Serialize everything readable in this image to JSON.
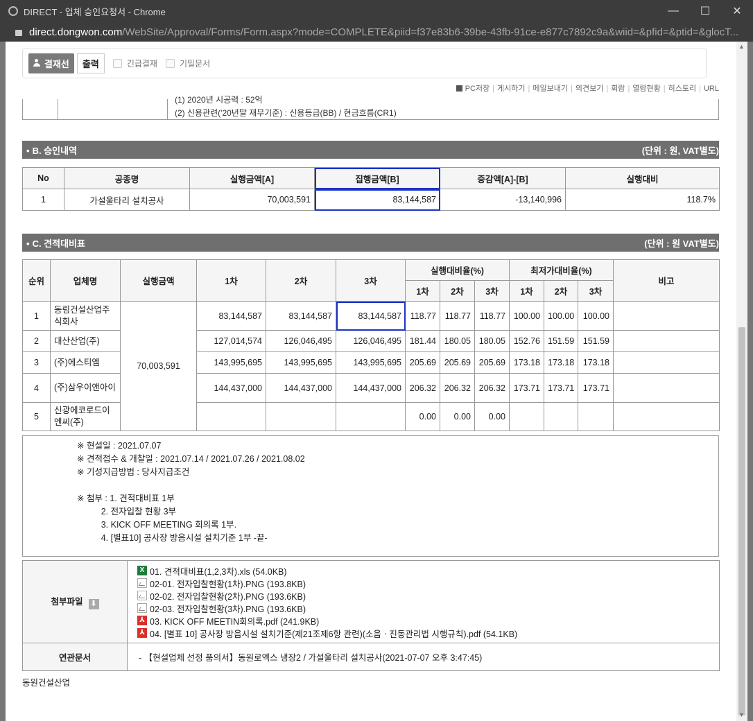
{
  "window": {
    "title": "DIRECT - 업체 승인요청서 - Chrome",
    "minimize": "—",
    "maximize": "☐",
    "close": "✕"
  },
  "address": {
    "host": "direct.dongwon.com",
    "path": "/WebSite/Approval/Forms/Form.aspx?mode=COMPLETE&piid=f37e83b6-39be-43fb-91ce-e877c7892c9a&wiid=&pfid=&ptid=&glocT..."
  },
  "toolbar": {
    "approve_label": "결재선",
    "print_label": "출력",
    "urgent_label": "긴급결재",
    "secret_label": "기밀문서"
  },
  "links": [
    "PC저장",
    "게시하기",
    "메일보내기",
    "의견보기",
    "회람",
    "열람현황",
    "히스토리",
    "URL"
  ],
  "prev_section": {
    "line1": "(1) 2020년 시공력 : 52억",
    "line2": "(2) 신용관련('20년말 재무기준) : 신용등급(BB) / 현금흐름(CR1)"
  },
  "section_b": {
    "title": "B. 승인내역",
    "unit": "(단위 : 원, VAT별도)",
    "headers": [
      "No",
      "공종명",
      "실행금액[A]",
      "집행금액[B]",
      "증감액[A]-[B]",
      "실행대비"
    ],
    "row": [
      "1",
      "가설울타리 설치공사",
      "70,003,591",
      "83,144,587",
      "-13,140,996",
      "118.7%"
    ]
  },
  "section_c": {
    "title": "C. 견적대비표",
    "unit": "(단위 : 원 VAT별도)",
    "headers": {
      "rank": "순위",
      "vendor": "업체명",
      "exec_amount": "실행금액",
      "r1": "1차",
      "r2": "2차",
      "r3": "3차",
      "exec_ratio": "실행대비율(%)",
      "min_ratio": "최저가대비율(%)",
      "sub1": "1차",
      "sub2": "2차",
      "sub3": "3차",
      "sub4": "1차",
      "sub5": "2차",
      "sub6": "3차",
      "note": "비고"
    },
    "exec_amount": "70,003,591",
    "rows": [
      {
        "rank": "1",
        "vendor": "동림건설산업주식회사",
        "r1": "83,144,587",
        "r2": "83,144,587",
        "r3": "83,144,587",
        "e1": "118.77",
        "e2": "118.77",
        "e3": "118.77",
        "m1": "100.00",
        "m2": "100.00",
        "m3": "100.00"
      },
      {
        "rank": "2",
        "vendor": "대산산업(주)",
        "r1": "127,014,574",
        "r2": "126,046,495",
        "r3": "126,046,495",
        "e1": "181.44",
        "e2": "180.05",
        "e3": "180.05",
        "m1": "152.76",
        "m2": "151.59",
        "m3": "151.59"
      },
      {
        "rank": "3",
        "vendor": "(주)에스티엠",
        "r1": "143,995,695",
        "r2": "143,995,695",
        "r3": "143,995,695",
        "e1": "205.69",
        "e2": "205.69",
        "e3": "205.69",
        "m1": "173.18",
        "m2": "173.18",
        "m3": "173.18"
      },
      {
        "rank": "4",
        "vendor": "(주)삼우이앤아이",
        "r1": "144,437,000",
        "r2": "144,437,000",
        "r3": "144,437,000",
        "e1": "206.32",
        "e2": "206.32",
        "e3": "206.32",
        "m1": "173.71",
        "m2": "173.71",
        "m3": "173.71"
      },
      {
        "rank": "5",
        "vendor": "신광에코로드이엔씨(주)",
        "r1": "",
        "r2": "",
        "r3": "",
        "e1": "0.00",
        "e2": "0.00",
        "e3": "0.00",
        "m1": "",
        "m2": "",
        "m3": ""
      }
    ]
  },
  "notes": [
    "※ 현설일 : 2021.07.07",
    "※ 견적접수 & 개찰일 : 2021.07.14 / 2021.07.26 / 2021.08.02",
    "※ 기성지급방법 : 당사지급조건",
    "",
    "※ 첨부 : 1. 견적대비표 1부",
    "          2. 전자입찰 현황 3부",
    "          3. KICK OFF MEETING 회의록 1부.",
    "          4. [별표10] 공사장 방음시설 설치기준 1부 -끝-"
  ],
  "attachments": {
    "label": "첨부파일",
    "files": [
      {
        "icon": "xls",
        "name": "01. 견적대비표(1,2,3차).xls (54.0KB)"
      },
      {
        "icon": "img",
        "name": "02-01. 전자입찰현황(1차).PNG (193.8KB)"
      },
      {
        "icon": "img",
        "name": "02-02. 전자입찰현황(2차).PNG (193.6KB)"
      },
      {
        "icon": "img",
        "name": "02-03. 전자입찰현황(3차).PNG (193.6KB)"
      },
      {
        "icon": "pdf",
        "name": "03. KICK OFF MEETIN회의록.pdf (241.9KB)"
      },
      {
        "icon": "pdf",
        "name": "04. [별표 10] 공사장 방음시설 설치기준(제21조제6항 관련)(소음ㆍ진동관리법 시행규칙).pdf (54.1KB)"
      }
    ]
  },
  "related": {
    "label": "연관문서",
    "value": "- 【현설업체 선정 품의서】동원로엑스 냉장2 / 가설울타리 설치공사(2021-07-07 오후 3:47:45)"
  },
  "company": "동원건설산업"
}
